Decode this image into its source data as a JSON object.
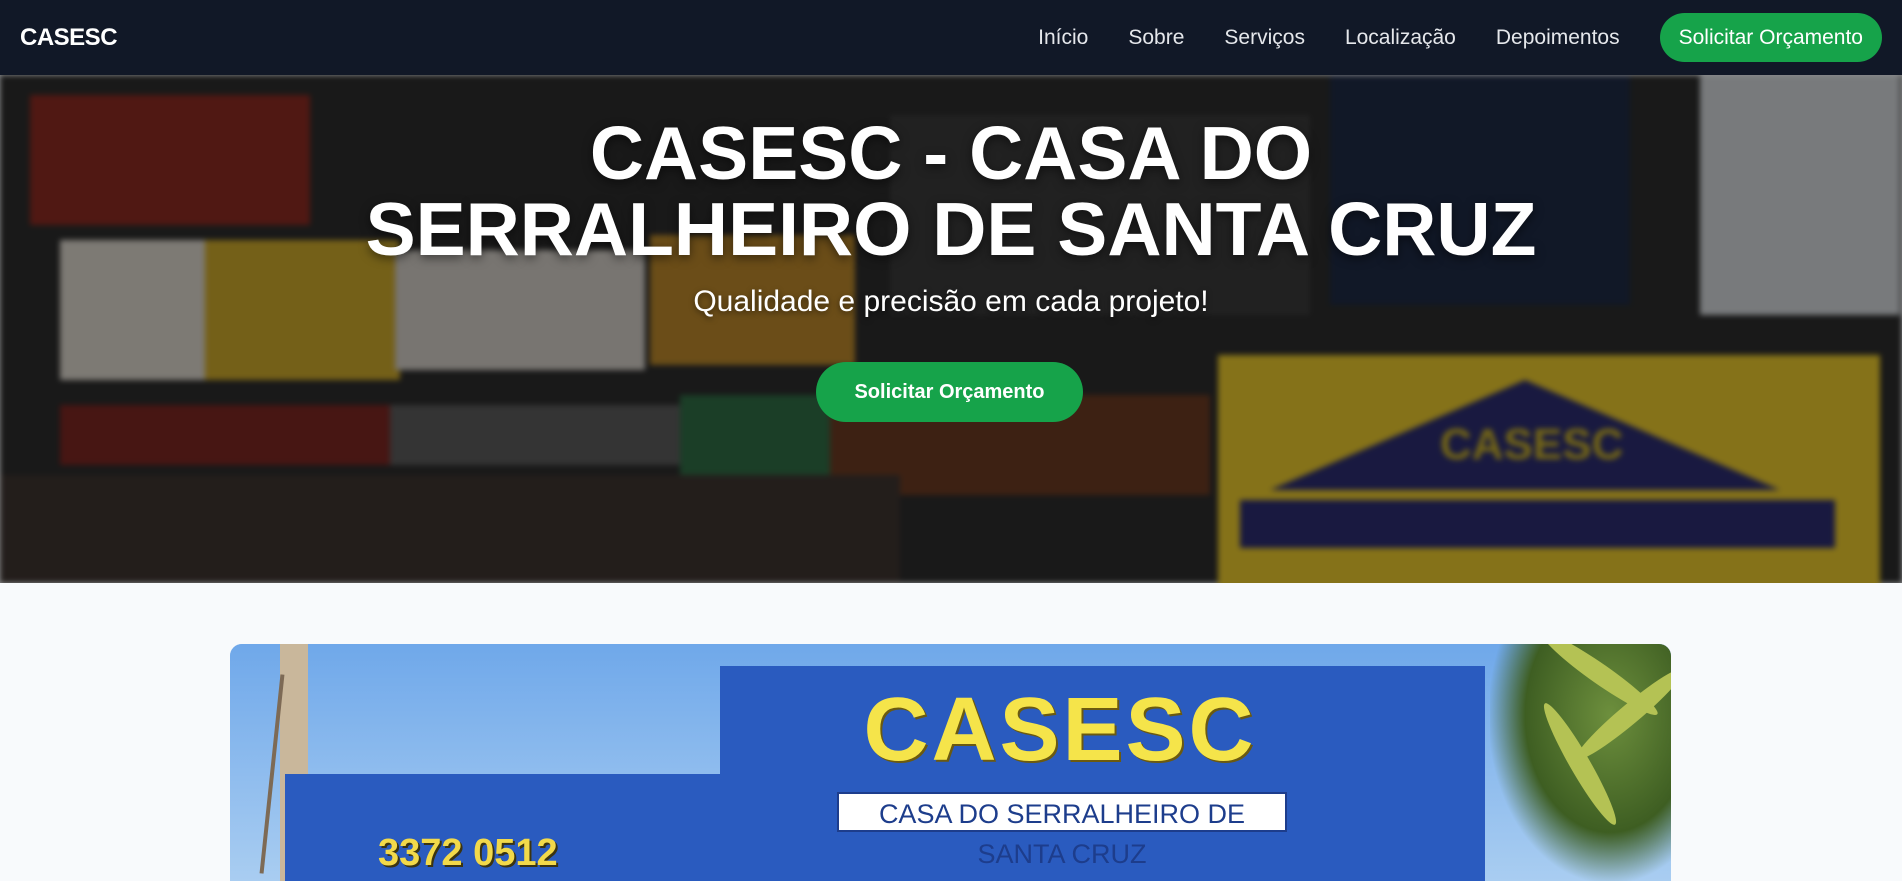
{
  "navbar": {
    "brand": "CASESC",
    "links": [
      "Início",
      "Sobre",
      "Serviços",
      "Localização",
      "Depoimentos"
    ],
    "cta": "Solicitar Orçamento"
  },
  "hero": {
    "title": "CASESC - CASA DO SERRALHEIRO DE SANTA CRUZ",
    "subtitle": "Qualidade e precisão em cada projeto!",
    "button": "Solicitar Orçamento",
    "sign_text": "CASESC"
  },
  "showcase": {
    "logo": "CASESC",
    "plate": "CASA DO SERRALHEIRO DE SANTA CRUZ",
    "phone": "3372 0512"
  },
  "colors": {
    "navbar": "#111827",
    "accent": "#16a34a",
    "page_bg": "#f8fafc"
  }
}
